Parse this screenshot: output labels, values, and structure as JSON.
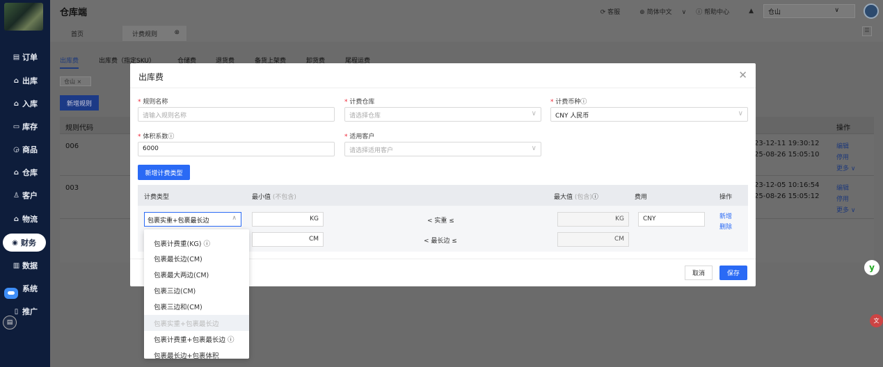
{
  "app": {
    "title": "仓库端"
  },
  "header": {
    "service": "客服",
    "language": "简体中文",
    "help": "帮助中心",
    "warehouse": "仓山"
  },
  "tabs": [
    {
      "label": "首页"
    },
    {
      "label": "计费规则"
    }
  ],
  "sidebar": {
    "items": [
      {
        "label": "订单"
      },
      {
        "label": "出库"
      },
      {
        "label": "入库"
      },
      {
        "label": "库存"
      },
      {
        "label": "商品"
      },
      {
        "label": "仓库"
      },
      {
        "label": "客户"
      },
      {
        "label": "物流"
      },
      {
        "label": "财务"
      },
      {
        "label": "数据"
      },
      {
        "label": "系统"
      },
      {
        "label": "推广"
      }
    ]
  },
  "subtabs": [
    {
      "label": "出库费"
    },
    {
      "label": "出库费（指定SKU）"
    },
    {
      "label": "仓储费"
    },
    {
      "label": "退货费"
    },
    {
      "label": "备货上架费"
    },
    {
      "label": "卸货费"
    },
    {
      "label": "尾程运费"
    }
  ],
  "filter_chip": "仓山 ×",
  "add_rule_label": "新增规则",
  "table": {
    "col_code": "规则代码",
    "col_action": "操作",
    "rows": [
      {
        "code": "006",
        "t1": "23-12-11 19:30:12",
        "t2": "25-08-26 15:05:10",
        "a1": "编辑",
        "a2": "停用",
        "a3": "更多 ∨"
      },
      {
        "code": "003",
        "t1": "23-12-05 10:16:54",
        "t2": "25-08-26 15:05:12",
        "a1": "编辑",
        "a2": "停用",
        "a3": "更多 ∨"
      }
    ]
  },
  "modal": {
    "title": "出库费",
    "rule_name_label": "规则名称",
    "rule_name_placeholder": "请输入规则名称",
    "warehouse_label": "计费仓库",
    "warehouse_placeholder": "请选择仓库",
    "currency_label": "计费币种",
    "currency_value": "CNY 人民币",
    "volume_label": "体积系数",
    "volume_value": "6000",
    "customer_label": "适用客户",
    "customer_placeholder": "请选择适用客户",
    "add_type_label": "新增计费类型",
    "fee_table": {
      "col_type": "计费类型",
      "col_min": "最小值",
      "col_min_note": "(不包含)",
      "col_max": "最大值",
      "col_max_note": "(包含)",
      "col_fee": "费用",
      "col_action": "操作",
      "type_value": "包裹实重+包裹最长边",
      "row1_min_unit": "KG",
      "row1_cond": "< 实重 ≤",
      "row1_max_unit": "KG",
      "fee_value": "CNY",
      "action_add": "新增",
      "action_delete": "删除",
      "row2_min_unit": "CM",
      "row2_cond": "< 最长边 ≤",
      "row2_max_unit": "CM"
    },
    "cancel_label": "取消",
    "save_label": "保存"
  },
  "dropdown_options": [
    {
      "label": "包裹计费重(KG) ⓘ"
    },
    {
      "label": "包裹最长边(CM)"
    },
    {
      "label": "包裹最大两边(CM)"
    },
    {
      "label": "包裹三边(CM)"
    },
    {
      "label": "包裹三边和(CM)"
    },
    {
      "label": "包裹实重+包裹最长边"
    },
    {
      "label": "包裹计费重+包裹最长边 ⓘ"
    },
    {
      "label": "包裹最长边+包裹体积"
    }
  ]
}
